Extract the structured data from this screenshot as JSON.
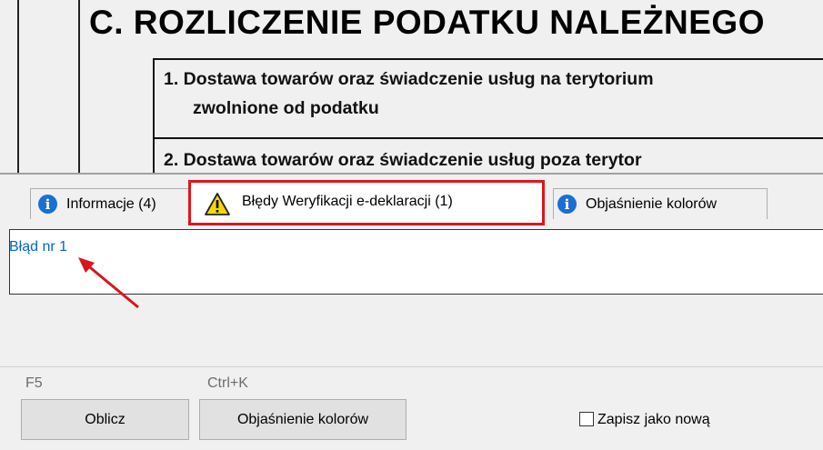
{
  "form": {
    "section_heading": "C. ROZLICZENIE PODATKU NALEŻNEGO",
    "row1_line1": "1. Dostawa towarów oraz świadczenie usług na terytorium",
    "row1_line2": "zwolnione od podatku",
    "row2_line1": "2. Dostawa towarów oraz świadczenie usług poza terytor"
  },
  "tabs": [
    {
      "label": "Informacje (4)",
      "icon": "info-icon"
    },
    {
      "label": "Błędy Weryfikacji e-deklaracji (1)",
      "icon": "warning-icon",
      "active": true
    },
    {
      "label": "Objaśnienie kolorów",
      "icon": "info-icon"
    }
  ],
  "errors_panel": {
    "link_text": "Błąd nr 1"
  },
  "footer": {
    "calc_shortcut": "F5",
    "calc_button": "Oblicz",
    "colors_shortcut": "Ctrl+K",
    "colors_button": "Objaśnienie kolorów",
    "save_as_new_label": "Zapisz jako nową",
    "save_as_new_checked": false
  },
  "colors": {
    "highlight_border": "#e2141b",
    "link": "#0066cc",
    "info_icon": "#1a6fd1",
    "warning_icon": "#f5d800",
    "arrow": "#d9151b"
  }
}
